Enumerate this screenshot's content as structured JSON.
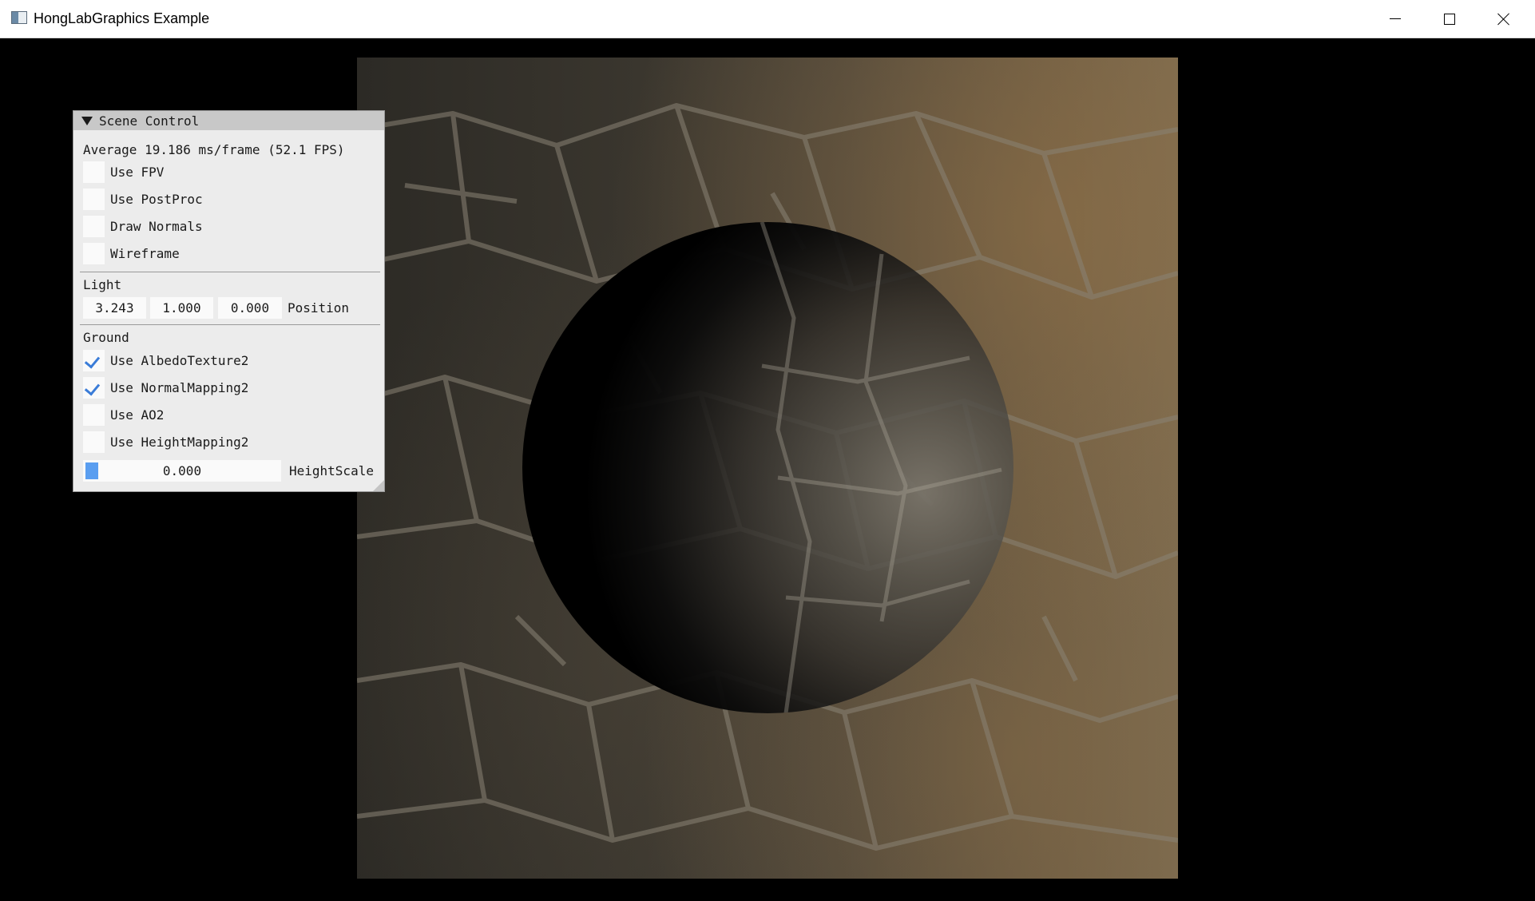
{
  "window": {
    "title": "HongLabGraphics Example",
    "icons": {
      "app": "app-window-icon",
      "minimize": "minimize-icon",
      "maximize": "maximize-icon",
      "close": "close-icon"
    }
  },
  "panel": {
    "title": "Scene Control",
    "fps_text": "Average 19.186 ms/frame (52.1 FPS)",
    "options": [
      {
        "label": "Use FPV",
        "checked": false
      },
      {
        "label": "Use PostProc",
        "checked": false
      },
      {
        "label": "Draw Normals",
        "checked": false
      },
      {
        "label": "Wireframe",
        "checked": false
      }
    ],
    "light": {
      "section_label": "Light",
      "position_label": "Position",
      "x": "3.243",
      "y": "1.000",
      "z": "0.000"
    },
    "ground": {
      "section_label": "Ground",
      "options": [
        {
          "label": "Use AlbedoTexture2",
          "checked": true
        },
        {
          "label": "Use NormalMapping2",
          "checked": true
        },
        {
          "label": "Use AO2",
          "checked": false
        },
        {
          "label": "Use HeightMapping2",
          "checked": false
        }
      ],
      "height_scale_label": "HeightScale",
      "height_scale_value": "0.000"
    }
  },
  "colors": {
    "panel_bg": "#ececec",
    "header_bg": "#c8c8c8",
    "accent": "#3a7cd8",
    "selection": "#6aa7f0"
  }
}
